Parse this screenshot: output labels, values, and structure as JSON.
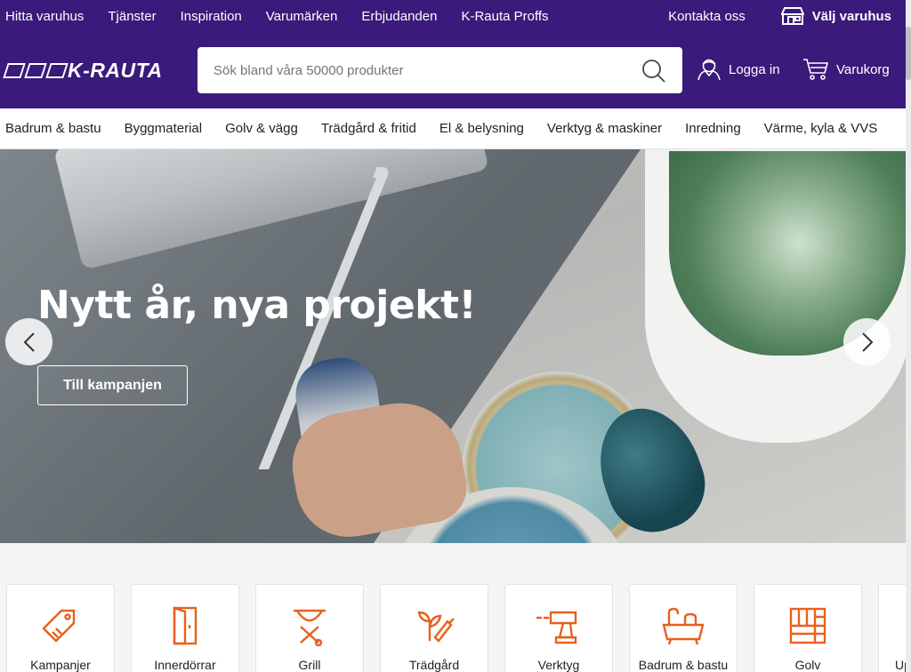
{
  "topbar": {
    "links": [
      "Hitta varuhus",
      "Tjänster",
      "Inspiration",
      "Varumärken",
      "Erbjudanden",
      "K-Rauta Proffs"
    ],
    "contact": "Kontakta oss",
    "store": "Välj varuhus"
  },
  "header": {
    "logo_text": "K-RAUTA",
    "search_placeholder": "Sök bland våra 50000 produkter",
    "login": "Logga in",
    "cart": "Varukorg"
  },
  "catnav": [
    "Badrum & bastu",
    "Byggmaterial",
    "Golv & vägg",
    "Trädgård & fritid",
    "El & belysning",
    "Verktyg & maskiner",
    "Inredning",
    "Värme, kyla & VVS"
  ],
  "hero": {
    "title": "Nytt år, nya projekt!",
    "cta": "Till kampanjen"
  },
  "tiles": [
    {
      "label": "Kampanjer",
      "icon": "tag-icon"
    },
    {
      "label": "Innerdörrar",
      "icon": "door-icon"
    },
    {
      "label": "Grill",
      "icon": "grill-icon"
    },
    {
      "label": "Trädgård",
      "icon": "garden-icon"
    },
    {
      "label": "Verktyg",
      "icon": "drill-icon"
    },
    {
      "label": "Badrum & bastu",
      "icon": "bathtub-icon"
    },
    {
      "label": "Golv",
      "icon": "floor-icon"
    },
    {
      "label": "Up",
      "icon": "more-icon"
    }
  ],
  "colors": {
    "brand": "#3a1a7a",
    "accent": "#e8601c"
  }
}
